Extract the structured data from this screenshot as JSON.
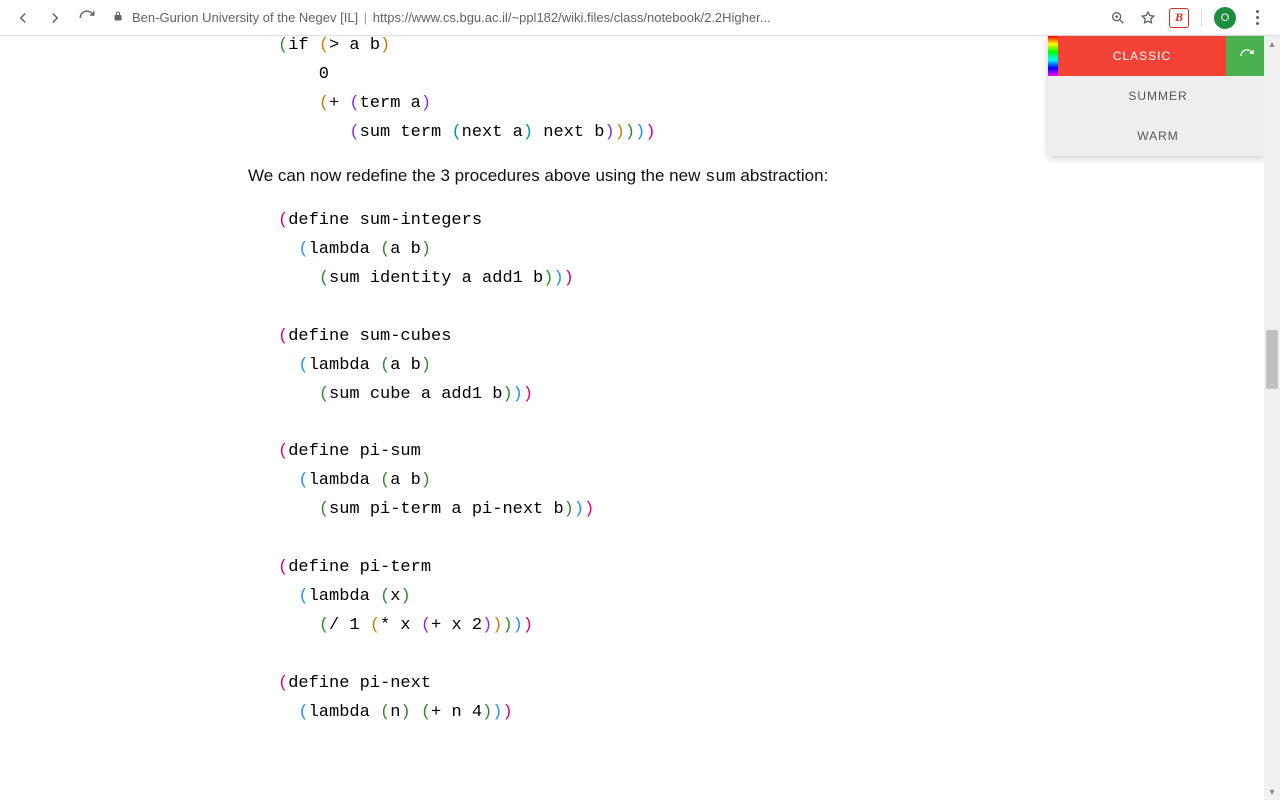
{
  "toolbar": {
    "site_title": "Ben-Gurion University of the Negev [IL]",
    "url": "https://www.cs.bgu.ac.il/~ppl182/wiki.files/class/notebook/2.2Higher...",
    "extension_letter": "B",
    "avatar_letter": "O"
  },
  "theme_panel": {
    "active": "CLASSIC",
    "options": [
      "SUMMER",
      "WARM"
    ]
  },
  "content": {
    "code_top_plain": "(if (> a b)\n    0\n    (+ (term a)\n       (sum term (next a) next b)))))",
    "paragraph_parts": {
      "pre": "We can now redefine the 3 procedures above using the new ",
      "code": "sum",
      "post": " abstraction:"
    },
    "code_defs_plain": "(define sum-integers\n  (lambda (a b)\n    (sum identity a add1 b)))\n\n(define sum-cubes\n  (lambda (a b)\n    (sum cube a add1 b)))\n\n(define pi-sum\n  (lambda (a b)\n    (sum pi-term a pi-next b)))\n\n(define pi-term\n  (lambda (x)\n    (/ 1 (* x (+ x 2)))))\n\n(define pi-next\n  (lambda (n) (+ n 4)))"
  },
  "scrollbar": {
    "thumb_top_pct": 38,
    "thumb_height_pct": 8
  }
}
